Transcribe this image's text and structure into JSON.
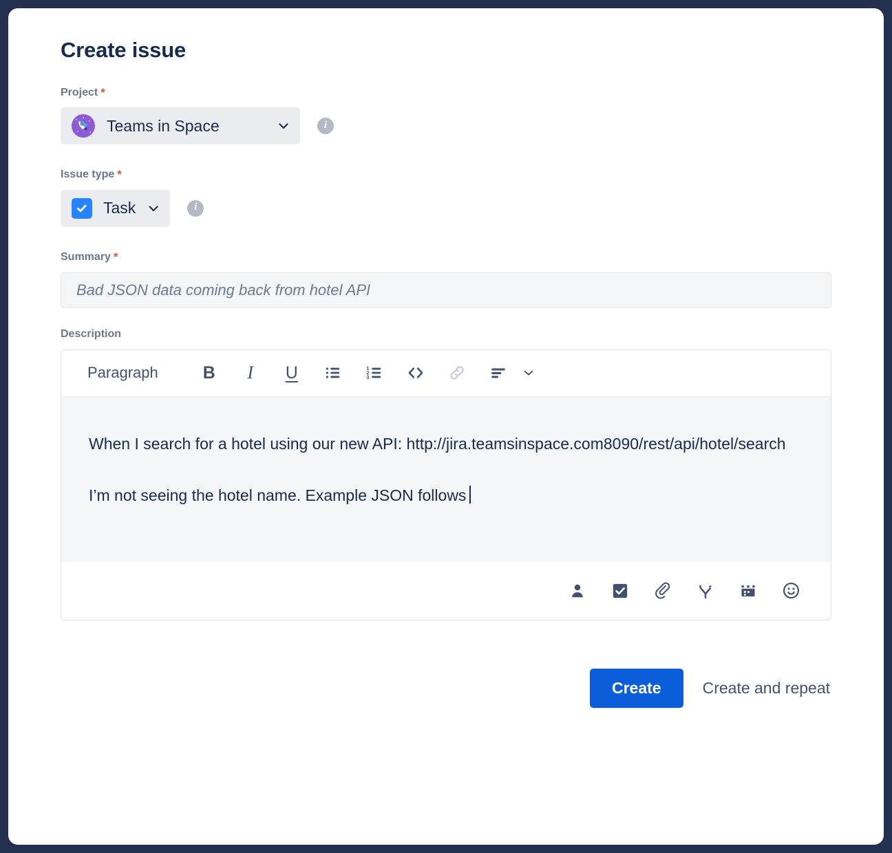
{
  "dialog": {
    "title": "Create issue"
  },
  "fields": {
    "project": {
      "label": "Project",
      "required_marker": "*",
      "value": "Teams in Space",
      "avatar_icon": "rocket-avatar-icon",
      "dropdown_icon": "chevron-down-icon",
      "info_icon": "info-icon",
      "info_glyph": "i"
    },
    "issue_type": {
      "label": "Issue type",
      "required_marker": "*",
      "value": "Task",
      "type_icon": "task-check-icon",
      "dropdown_icon": "chevron-down-icon",
      "info_icon": "info-icon",
      "info_glyph": "i"
    },
    "summary": {
      "label": "Summary",
      "required_marker": "*",
      "value": "",
      "placeholder": "Bad JSON data coming back from hotel API"
    },
    "description": {
      "label": "Description",
      "toolbar": {
        "block_style": "Paragraph",
        "bold": "B",
        "italic": "I",
        "underline": "U",
        "buttons": [
          {
            "name": "bullet-list-icon",
            "label": "Bulleted list",
            "disabled": false
          },
          {
            "name": "numbered-list-icon",
            "label": "Numbered list",
            "disabled": false
          },
          {
            "name": "code-icon",
            "label": "Code",
            "disabled": false
          },
          {
            "name": "link-icon",
            "label": "Link",
            "disabled": true
          },
          {
            "name": "text-align-icon",
            "label": "Alignment",
            "disabled": false
          },
          {
            "name": "chevron-down-icon",
            "label": "More options",
            "disabled": false
          }
        ]
      },
      "paragraphs": [
        "When I search for a hotel using our new API: http://jira.teamsinspace.com8090/rest/api/hotel/search",
        "I’m not seeing the hotel name. Example JSON follows"
      ],
      "footer_icons": [
        {
          "name": "mention-person-icon",
          "label": "Mention"
        },
        {
          "name": "task-checkbox-icon",
          "label": "Action item"
        },
        {
          "name": "attachment-paperclip-icon",
          "label": "Attach file"
        },
        {
          "name": "branch-decision-icon",
          "label": "Insert"
        },
        {
          "name": "calendar-date-icon",
          "label": "Date"
        },
        {
          "name": "emoji-smiley-icon",
          "label": "Emoji"
        }
      ]
    }
  },
  "actions": {
    "create_label": "Create",
    "create_and_repeat_label": "Create and repeat"
  },
  "colors": {
    "frame": "#24304f",
    "card": "#ffffff",
    "primary_button": "#0b5ed7",
    "label_text": "#6b778c",
    "body_text": "#172b4d",
    "required_star": "#de5246",
    "pill_background": "#ebecf0",
    "field_background": "#f4f5f7",
    "task_icon": "#2684ff",
    "project_avatar": "#8b5cd6"
  }
}
